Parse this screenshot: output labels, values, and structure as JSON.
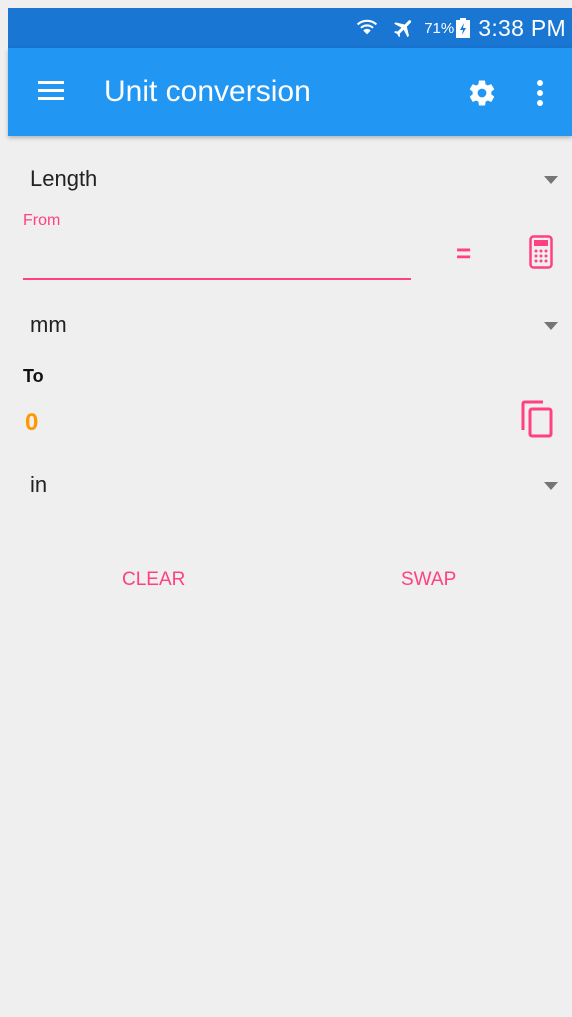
{
  "status_bar": {
    "battery_percent": "71%",
    "time": "3:38 PM",
    "icons": [
      "wifi-icon",
      "airplane-mode-icon",
      "battery-charging-icon"
    ]
  },
  "app_bar": {
    "title": "Unit conversion",
    "icons": [
      "menu-icon",
      "gear-icon",
      "more-vert-icon"
    ]
  },
  "category": {
    "selected": "Length"
  },
  "from": {
    "label": "From",
    "value": "",
    "unit": "mm"
  },
  "equals_symbol": "=",
  "to": {
    "label": "To",
    "value": "0",
    "unit": "in"
  },
  "actions": {
    "clear_label": "CLEAR",
    "swap_label": "SWAP"
  },
  "colors": {
    "status_bar": "#1976d2",
    "app_bar": "#2196f3",
    "accent": "#ff4081",
    "result": "#ff9800",
    "background": "#efefef"
  }
}
